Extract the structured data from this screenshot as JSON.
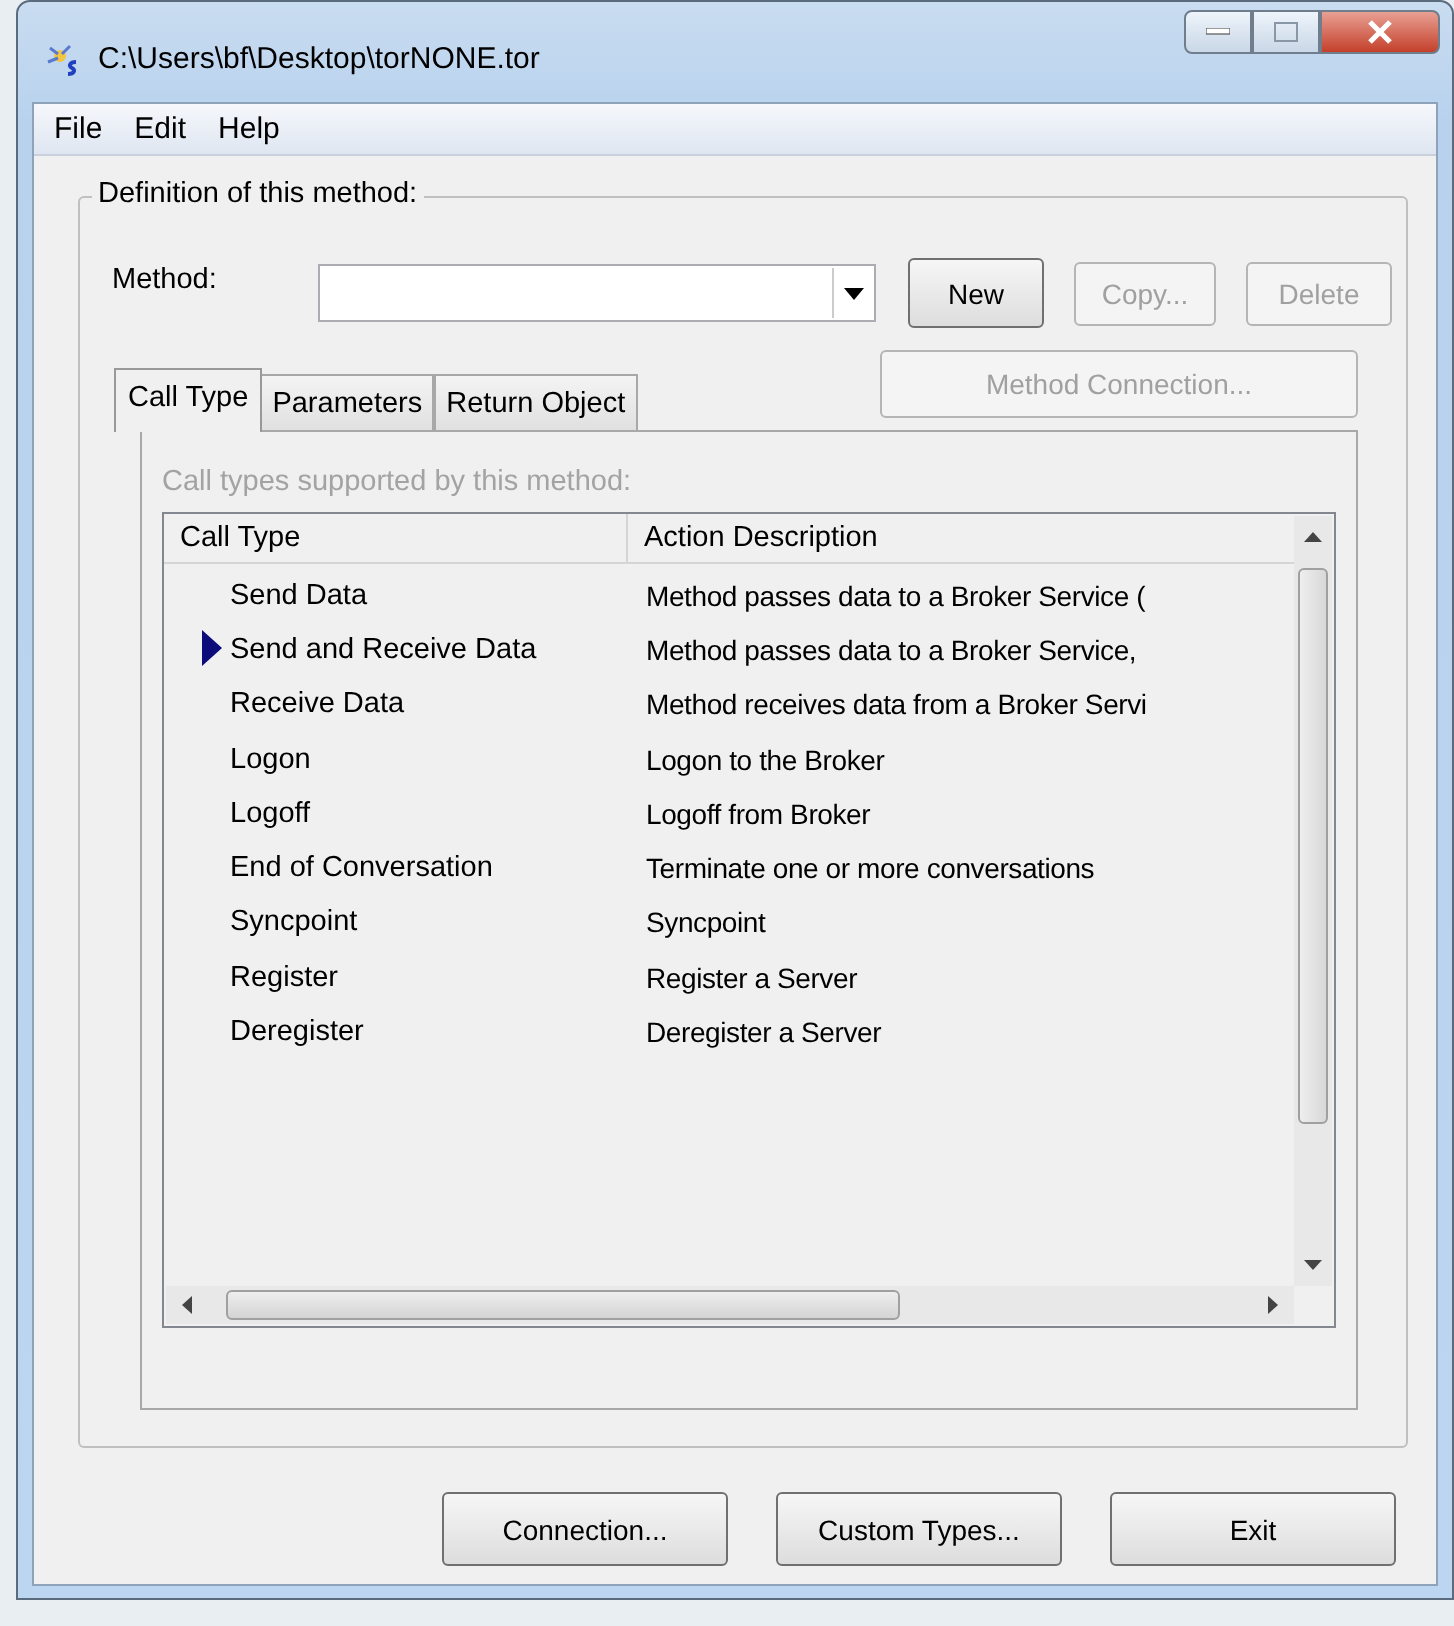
{
  "window": {
    "title": "C:\\Users\\bf\\Desktop\\torNONE.tor"
  },
  "menu": [
    "File",
    "Edit",
    "Help"
  ],
  "group": {
    "title": "Definition of this method:",
    "method": {
      "label": "Method:"
    },
    "buttons": [
      {
        "label": "New",
        "disabled": false
      },
      {
        "label": "Copy...",
        "disabled": true
      },
      {
        "label": "Delete",
        "disabled": true
      }
    ],
    "connection_button": {
      "label": "Method Connection...",
      "disabled": true
    },
    "tabs": [
      {
        "label": "Call Type",
        "selected": true
      },
      {
        "label": "Parameters",
        "selected": false
      },
      {
        "label": "Return Object",
        "selected": false
      }
    ],
    "caption": "Call types supported by this method:",
    "table": {
      "columns": [
        "Call Type",
        "Action Description"
      ],
      "rows": [
        {
          "call_type": "Send Data",
          "description": "Method passes data to a Broker Service (",
          "selected": false
        },
        {
          "call_type": "Send and Receive Data",
          "description": "Method passes data to a Broker Service,",
          "selected": true
        },
        {
          "call_type": "Receive Data",
          "description": "Method receives data from a Broker Servi",
          "selected": false
        },
        {
          "call_type": "Logon",
          "description": "Logon to the Broker",
          "selected": false
        },
        {
          "call_type": "Logoff",
          "description": "Logoff from Broker",
          "selected": false
        },
        {
          "call_type": "End of Conversation",
          "description": "Terminate one or more conversations",
          "selected": false
        },
        {
          "call_type": "Syncpoint",
          "description": "Syncpoint",
          "selected": false
        },
        {
          "call_type": "Register",
          "description": "Register a Server",
          "selected": false
        },
        {
          "call_type": "Deregister",
          "description": "Deregister a Server",
          "selected": false
        }
      ]
    }
  },
  "footer_buttons": [
    {
      "label": "Connection...",
      "disabled": false
    },
    {
      "label": "Custom Types...",
      "disabled": false
    },
    {
      "label": "Exit",
      "disabled": false
    }
  ]
}
